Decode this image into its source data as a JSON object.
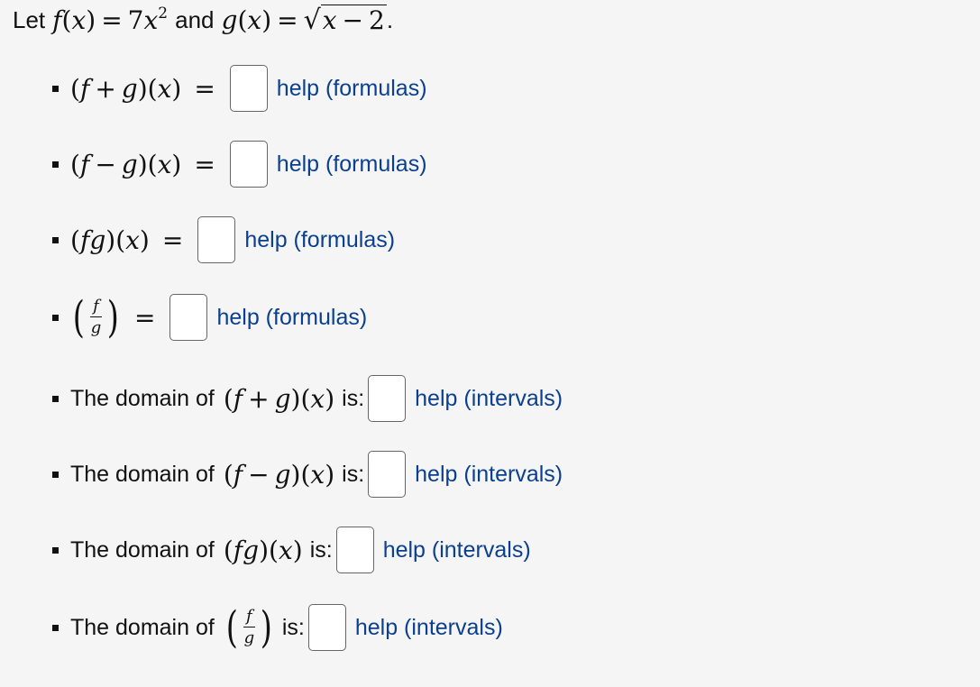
{
  "intro": {
    "lead": "Let",
    "and_word": "and",
    "period": ".",
    "f": {
      "name": "f",
      "var": "x",
      "coef": "7",
      "power": "2"
    },
    "g": {
      "name": "g",
      "var": "x",
      "radicand_var": "x",
      "radicand_minus": "−",
      "radicand_const": "2"
    }
  },
  "symbols": {
    "equals": "=",
    "plus": "+",
    "minus": "−",
    "lparen": "(",
    "rparen": ")",
    "f": "f",
    "g": "g",
    "x": "x"
  },
  "help": {
    "formulas": "help (formulas)",
    "intervals": "help (intervals)"
  },
  "domain": {
    "prefix": "The domain of",
    "suffix": "is:"
  },
  "items": [
    {
      "kind": "formula",
      "op": "sum"
    },
    {
      "kind": "formula",
      "op": "difference"
    },
    {
      "kind": "formula",
      "op": "product"
    },
    {
      "kind": "formula",
      "op": "quotient"
    },
    {
      "kind": "domain",
      "op": "sum"
    },
    {
      "kind": "domain",
      "op": "difference"
    },
    {
      "kind": "domain",
      "op": "product"
    },
    {
      "kind": "domain",
      "op": "quotient"
    }
  ]
}
